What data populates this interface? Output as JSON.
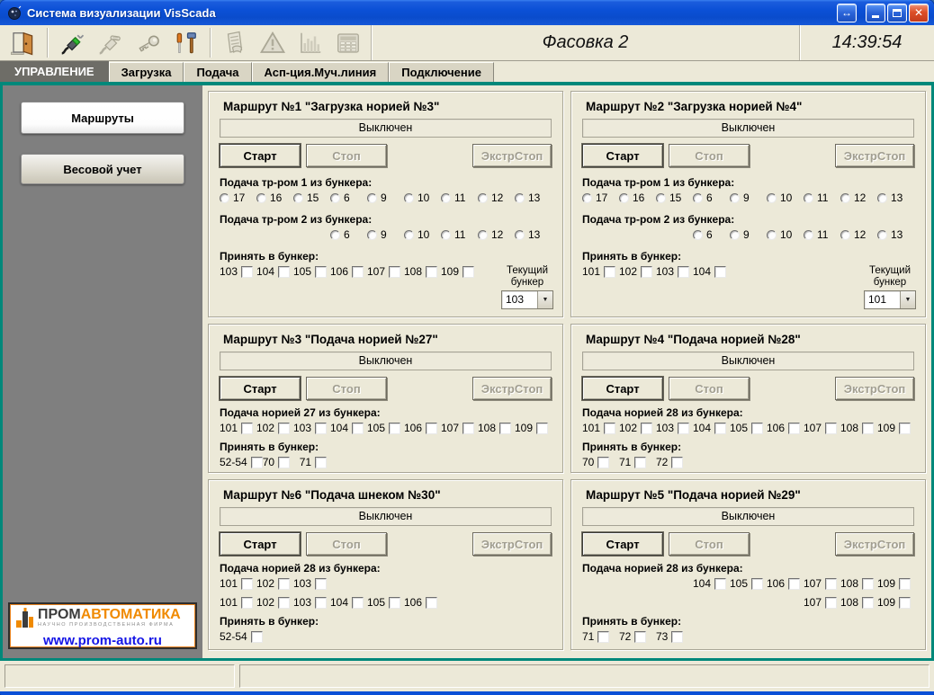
{
  "window": {
    "title": "Система визуализации VisScada",
    "controls": {
      "resize": "resize",
      "minimize": "minimize",
      "maximize": "maximize",
      "close": "close"
    }
  },
  "toolbar": {
    "buttons": [
      {
        "icon": "exit-door-icon",
        "enabled": true
      },
      {
        "icon": "connector-active-icon",
        "enabled": true
      },
      {
        "icon": "connector-icon",
        "enabled": false
      },
      {
        "icon": "key-icon",
        "enabled": false
      },
      {
        "icon": "tools-icon",
        "enabled": true
      },
      {
        "icon": "report-icon",
        "enabled": false
      },
      {
        "icon": "warning-icon",
        "enabled": false
      },
      {
        "icon": "chart-icon",
        "enabled": false
      },
      {
        "icon": "device-icon",
        "enabled": false
      }
    ],
    "workspace_label": "Фасовка 2",
    "clock": "14:39:54"
  },
  "tabs": [
    {
      "label": "УПРАВЛЕНИЕ",
      "active": true
    },
    {
      "label": "Загрузка",
      "active": false
    },
    {
      "label": "Подача",
      "active": false
    },
    {
      "label": "Асп-ция.Муч.линия",
      "active": false
    },
    {
      "label": "Подключение",
      "active": false
    }
  ],
  "sidebar": {
    "buttons": [
      {
        "label": "Маршруты"
      },
      {
        "label": "Весовой учет"
      }
    ],
    "logo": {
      "brand_black": "ПРОМ",
      "brand_orange": "АВТОМАТИКА",
      "tagline": "НАУЧНО ПРОИЗВОДСТВЕННАЯ ФИРМА",
      "url": "www.prom-auto.ru",
      "brand_color": "#f08a00",
      "url_color": "#1414e6"
    }
  },
  "route_buttons": {
    "start": "Старт",
    "stop": "Стоп",
    "estop": "ЭкстрСтоп"
  },
  "panels": [
    {
      "title": "Маршрут №1 \"Загрузка норией №3\"",
      "status": "Выключен",
      "groups": [
        {
          "type": "radio",
          "label": "Подача тр-ром 1 из бункера:",
          "rows": [
            {
              "offset": 0,
              "items": [
                "17",
                "16",
                "15",
                "6",
                "9",
                "10",
                "11",
                "12",
                "13"
              ]
            }
          ]
        },
        {
          "type": "radio",
          "label": "Подача тр-ром 2 из бункера:",
          "rows": [
            {
              "offset": 3,
              "items": [
                "6",
                "9",
                "10",
                "11",
                "12",
                "13"
              ]
            }
          ]
        },
        {
          "type": "checkbox",
          "label": "Принять в бункер:",
          "rows": [
            {
              "offset": 0,
              "items": [
                "103",
                "104",
                "105",
                "106",
                "107",
                "108",
                "109"
              ]
            }
          ]
        }
      ],
      "current_bunker": {
        "label": "Текущий бункер",
        "value": "103"
      }
    },
    {
      "title": "Маршрут №2 \"Загрузка норией №4\"",
      "status": "Выключен",
      "groups": [
        {
          "type": "radio",
          "label": "Подача тр-ром 1 из бункера:",
          "rows": [
            {
              "offset": 0,
              "items": [
                "17",
                "16",
                "15",
                "6",
                "9",
                "10",
                "11",
                "12",
                "13"
              ]
            }
          ]
        },
        {
          "type": "radio",
          "label": "Подача тр-ром 2 из бункера:",
          "rows": [
            {
              "offset": 3,
              "items": [
                "6",
                "9",
                "10",
                "11",
                "12",
                "13"
              ]
            }
          ]
        },
        {
          "type": "checkbox",
          "label": "Принять в бункер:",
          "rows": [
            {
              "offset": 0,
              "items": [
                "101",
                "102",
                "103",
                "104"
              ]
            }
          ]
        }
      ],
      "current_bunker": {
        "label": "Текущий бункер",
        "value": "101"
      }
    },
    {
      "title": "Маршрут №3 \"Подача норией №27\"",
      "status": "Выключен",
      "groups": [
        {
          "type": "checkbox",
          "label": "Подача норией 27 из бункера:",
          "rows": [
            {
              "offset": 0,
              "items": [
                "101",
                "102",
                "103",
                "104",
                "105",
                "106",
                "107",
                "108",
                "109"
              ]
            }
          ]
        },
        {
          "type": "checkbox",
          "label": "Принять в бункер:",
          "rows": [
            {
              "offset": 0,
              "items": [
                "52-54",
                "70",
                "71"
              ]
            }
          ]
        }
      ]
    },
    {
      "title": "Маршрут №4 \"Подача норией №28\"",
      "status": "Выключен",
      "groups": [
        {
          "type": "checkbox",
          "label": "Подача норией 28 из бункера:",
          "rows": [
            {
              "offset": 0,
              "items": [
                "101",
                "102",
                "103",
                "104",
                "105",
                "106",
                "107",
                "108",
                "109"
              ]
            }
          ]
        },
        {
          "type": "checkbox",
          "label": "Принять в бункер:",
          "rows": [
            {
              "offset": 0,
              "items": [
                "70",
                "71",
                "72"
              ]
            }
          ]
        }
      ]
    },
    {
      "title": "Маршрут №6 \"Подача шнеком №30\"",
      "status": "Выключен",
      "groups": [
        {
          "type": "checkbox",
          "label": "Подача норией 28 из бункера:",
          "rows": [
            {
              "offset": 0,
              "items": [
                "101",
                "102",
                "103"
              ]
            },
            {
              "offset": 0,
              "items": [
                "101",
                "102",
                "103",
                "104",
                "105",
                "106"
              ]
            }
          ]
        },
        {
          "type": "checkbox",
          "label": "Принять в бункер:",
          "rows": [
            {
              "offset": 0,
              "items": [
                "52-54"
              ]
            }
          ]
        }
      ]
    },
    {
      "title": "Маршрут №5 \"Подача норией №29\"",
      "status": "Выключен",
      "groups": [
        {
          "type": "checkbox",
          "label": "Подача норией 28 из бункера:",
          "rows": [
            {
              "offset": 3,
              "items": [
                "104",
                "105",
                "106",
                "107",
                "108",
                "109"
              ]
            },
            {
              "offset": 6,
              "items": [
                "107",
                "108",
                "109"
              ]
            }
          ]
        },
        {
          "type": "checkbox",
          "label": "Принять в бункер:",
          "rows": [
            {
              "offset": 0,
              "items": [
                "71",
                "72",
                "73"
              ]
            }
          ]
        }
      ]
    }
  ],
  "statusbar": {
    "left": "",
    "right": ""
  }
}
